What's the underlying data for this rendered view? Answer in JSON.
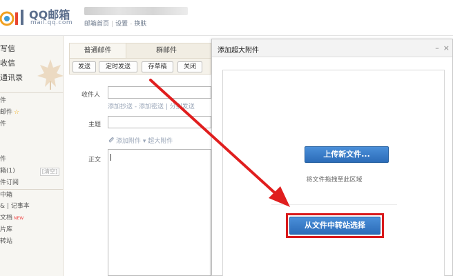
{
  "header": {
    "logo_title": "QQ邮箱",
    "logo_sub": "mail.qq.com",
    "links": [
      "邮箱首页",
      "设置",
      "换肤"
    ]
  },
  "sidebar": {
    "main_nav": [
      "写信",
      "收信",
      "通讯录"
    ],
    "folders": [
      {
        "label": "件",
        "extra": ""
      },
      {
        "label": "邮件",
        "extra": "star"
      },
      {
        "label": "件",
        "extra": ""
      },
      {
        "label": "",
        "extra": ""
      },
      {
        "label": "",
        "extra": ""
      },
      {
        "label": "件",
        "extra": ""
      },
      {
        "label": "箱(1)",
        "extra": "[清空]"
      },
      {
        "label": "件订阅",
        "extra": ""
      },
      {
        "label": "中箱",
        "extra": ""
      },
      {
        "label": "& | 记事本",
        "extra": ""
      },
      {
        "label": "文档",
        "extra": "NEW"
      },
      {
        "label": "片库",
        "extra": ""
      },
      {
        "label": "转站",
        "extra": ""
      }
    ]
  },
  "compose": {
    "tabs": [
      "普通邮件",
      "群邮件"
    ],
    "toolbar": [
      "发送",
      "定时发送",
      "存草稿",
      "关闭"
    ],
    "recipient_label": "收件人",
    "recipient_hint": "添加抄送 - 添加密送 | 分别发送",
    "subject_label": "主题",
    "attach_hint": "添加附件 ▾  超大附件",
    "body_label": "正文"
  },
  "dialog": {
    "title": "添加超大附件",
    "minimize": "–",
    "close": "×",
    "upload_button": "上传新文件...",
    "drag_tip": "将文件拖拽至此区域",
    "pick_button": "从文件中转站选择"
  },
  "colors": {
    "accent_blue": "#2c6cb8",
    "highlight_red": "#d9191b",
    "sidebar_bg": "#f7f6f2"
  }
}
